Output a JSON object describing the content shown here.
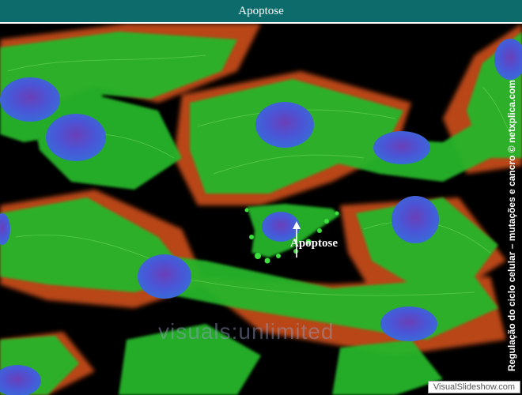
{
  "header": {
    "title": "Apoptose"
  },
  "image": {
    "annotation_label": "Apoptose",
    "side_credit": "Regulação do ciclo celular – mutações e cancro © netxplica.com",
    "watermark_text": "visuals:unlimited"
  },
  "footer": {
    "source_badge": "VisualSlideshow.com"
  },
  "colors": {
    "title_bar": "#0e6b6b",
    "cytoskeleton": "#2fbf2f",
    "nucleus": "#4a55d6",
    "actin_edge": "#e05a1a",
    "background": "#000000"
  }
}
